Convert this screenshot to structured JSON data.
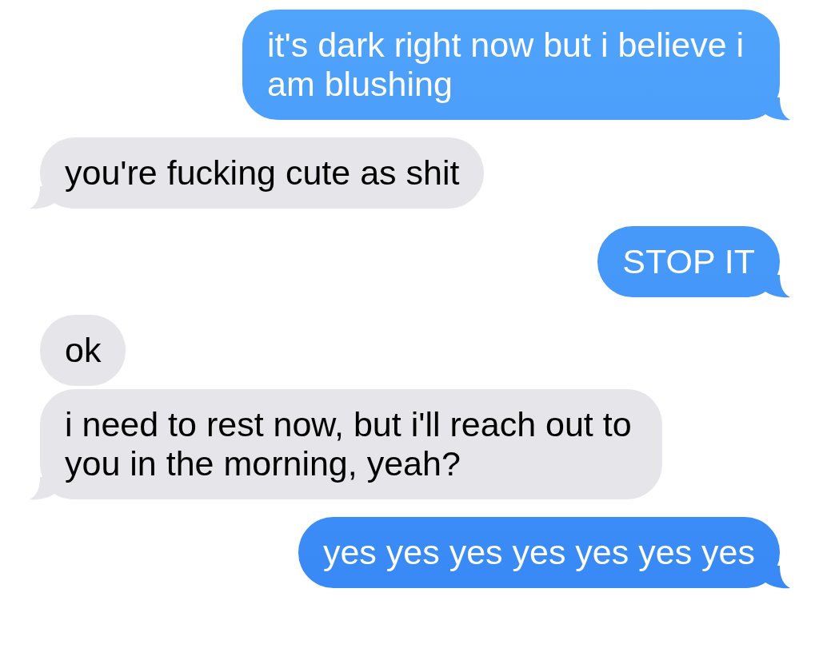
{
  "messages": [
    {
      "kind": "sent",
      "text": "it's dark right now but i believe i am blushing",
      "tail": true
    },
    {
      "kind": "received",
      "text": "you're fucking cute as shit",
      "tail": true
    },
    {
      "kind": "sent",
      "text": "STOP IT",
      "tail": true
    },
    {
      "kind": "received",
      "text": "ok",
      "tail": false
    },
    {
      "kind": "received",
      "text": "i need to rest now, but i'll reach out to you in the morning, yeah?",
      "tail": true
    },
    {
      "kind": "sent",
      "text": "yes yes yes yes yes yes yes",
      "tail": true
    }
  ]
}
